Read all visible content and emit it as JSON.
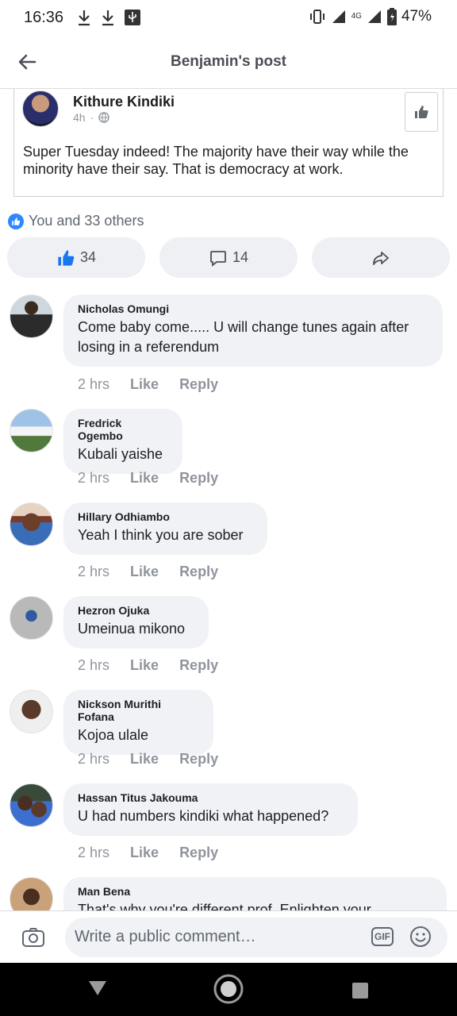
{
  "status_bar": {
    "time": "16:36",
    "network": "4G",
    "battery": "47%"
  },
  "header": {
    "title": "Benjamin's post"
  },
  "shared_post": {
    "author": "Kithure Kindiki",
    "time": "4h",
    "separator": "·",
    "text": "Super Tuesday indeed! The majority have their way while the minority have their say. That is democracy at work."
  },
  "reactions": {
    "summary": "You and 33 others",
    "like_count": "34",
    "comment_count": "14"
  },
  "comments": [
    {
      "name": "Nicholas Omungi",
      "text": "Come baby come..... U will change tunes again after losing in a referendum",
      "time": "2 hrs",
      "like": "Like",
      "reply": "Reply"
    },
    {
      "name": "Fredrick Ogembo",
      "text": "Kubali yaishe",
      "time": "2 hrs",
      "like": "Like",
      "reply": "Reply"
    },
    {
      "name": "Hillary Odhiambo",
      "text": "Yeah I think you are sober",
      "time": "2 hrs",
      "like": "Like",
      "reply": "Reply"
    },
    {
      "name": "Hezron Ojuka",
      "text": "Umeinua mikono",
      "time": "2 hrs",
      "like": "Like",
      "reply": "Reply"
    },
    {
      "name": "Nickson Murithi Fofana",
      "text": "Kojoa ulale",
      "time": "2 hrs",
      "like": "Like",
      "reply": "Reply"
    },
    {
      "name": "Hassan Titus Jakouma",
      "text": "U had numbers kindiki what happened?",
      "time": "2 hrs",
      "like": "Like",
      "reply": "Reply"
    },
    {
      "name": "Man Bena",
      "text": "That's why you're different prof. Enlighten your"
    }
  ],
  "composer": {
    "placeholder": "Write a public comment…",
    "gif_label": "GIF"
  },
  "colors": {
    "accent": "#1877f2",
    "bubble": "#f0f2f5"
  }
}
